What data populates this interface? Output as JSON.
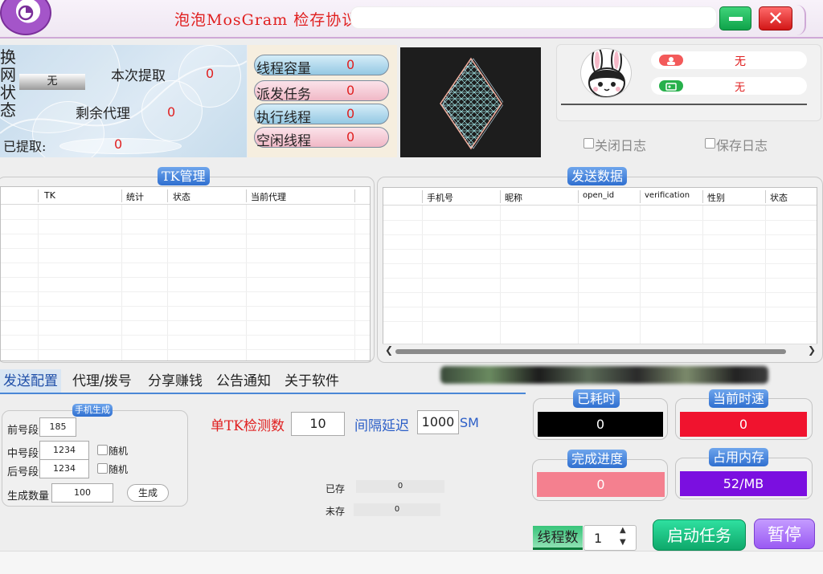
{
  "window": {
    "title": "泡泡MosGram 检存协议",
    "close_glyph": "✕"
  },
  "status_panel": {
    "switch_label": "换网状态",
    "switch_value": "无",
    "extract_label": "本次提取",
    "extract_value": "0",
    "remaining_label": "剩余代理",
    "remaining_value": "0",
    "extracted_label": "已提取:",
    "extracted_value": "0"
  },
  "threads": [
    {
      "label": "线程容量",
      "value": "0",
      "color": "blue"
    },
    {
      "label": "派发任务",
      "value": "0",
      "color": "pink"
    },
    {
      "label": "执行线程",
      "value": "0",
      "color": "blue"
    },
    {
      "label": "空闲线程",
      "value": "0",
      "color": "pink"
    }
  ],
  "user": {
    "row1_value": "无",
    "row1_icon": "user-icon",
    "row1_color": "#f35a5a",
    "row2_value": "无",
    "row2_icon": "id-card-icon",
    "row2_color": "#27b04b"
  },
  "log_options": {
    "close_log": "关闭日志",
    "save_log": "保存日志"
  },
  "tk_panel": {
    "title": "TK管理",
    "columns": [
      "TK",
      "统计",
      "状态",
      "当前代理"
    ]
  },
  "send_panel": {
    "title": "发送数据",
    "columns": [
      "手机号",
      "昵称",
      "open_id",
      "verification",
      "性别",
      "状态"
    ]
  },
  "tabs": [
    {
      "label": "发送配置",
      "active": true
    },
    {
      "label": "代理/拨号",
      "active": false
    },
    {
      "label": "分享赚钱",
      "active": false
    },
    {
      "label": "公告通知",
      "active": false
    },
    {
      "label": "关于软件",
      "active": false
    }
  ],
  "config": {
    "group_title": "手机生成",
    "prefix_label": "前号段",
    "prefix_value": "185",
    "middle_label": "中号段",
    "middle_value": "1234",
    "middle_random": "随机",
    "suffix_label": "后号段",
    "suffix_value": "1234",
    "suffix_random": "随机",
    "count_label": "生成数量",
    "count_value": "100",
    "generate_btn": "生成",
    "tk_check_label": "单TK检测数",
    "tk_check_value": "10",
    "delay_label": "间隔延迟",
    "delay_value": "1000",
    "delay_unit": "SM",
    "exist_label": "已存",
    "exist_value": "0",
    "not_exist_label": "未存",
    "not_exist_value": "0"
  },
  "stats": {
    "elapsed_label": "已耗时",
    "elapsed_value": "0",
    "elapsed_color": "#000000",
    "speed_label": "当前时速",
    "speed_value": "0",
    "speed_color": "#f0132e",
    "progress_label": "完成进度",
    "progress_value": "0",
    "progress_color": "#f4808f",
    "memory_label": "占用内存",
    "memory_value": "52/MB",
    "memory_color": "#7b0fe0"
  },
  "controls": {
    "thread_label": "线程数",
    "thread_value": "1",
    "start_btn": "启动任务",
    "pause_btn": "暂停"
  }
}
